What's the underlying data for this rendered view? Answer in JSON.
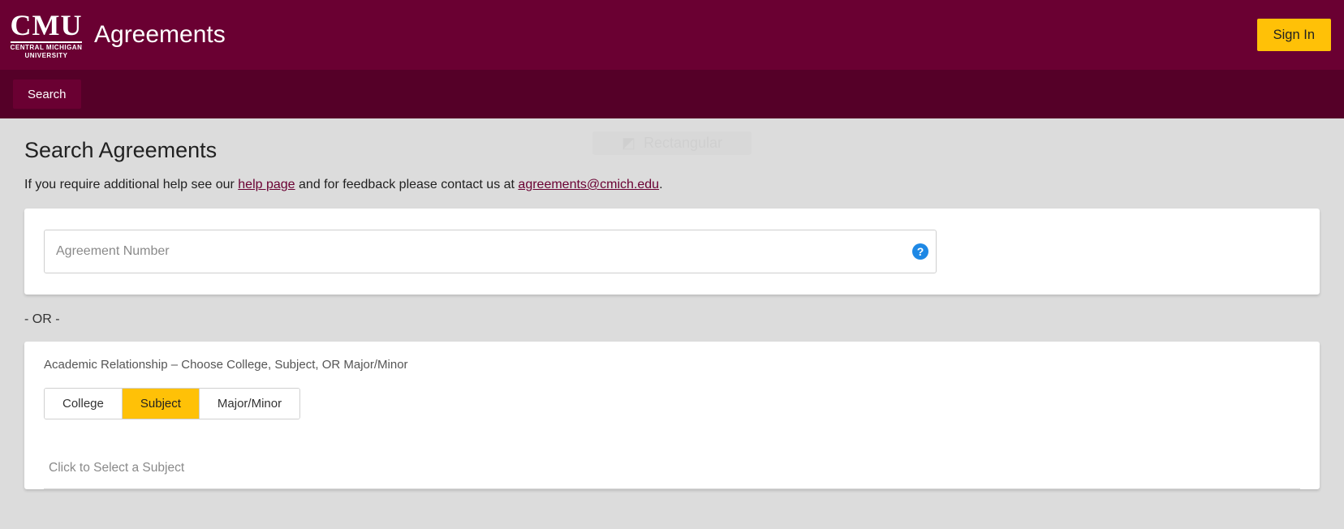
{
  "header": {
    "logo_main": "CMU",
    "logo_sub1": "CENTRAL MICHIGAN",
    "logo_sub2": "UNIVERSITY",
    "app_title": "Agreements",
    "signin_label": "Sign In"
  },
  "nav": {
    "search_label": "Search"
  },
  "page": {
    "title": "Search Agreements",
    "help_prefix": "If you require additional help see our ",
    "help_link_text": "help page",
    "help_mid": " and for feedback please contact us at ",
    "help_email": "agreements@cmich.edu",
    "help_suffix": "."
  },
  "overlay_text": "Rectangular",
  "search1": {
    "agreement_placeholder": "Agreement Number",
    "agreement_value": "",
    "help_icon_char": "?"
  },
  "divider": "- OR -",
  "search2": {
    "academic_label": "Academic Relationship – Choose College, Subject, OR Major/Minor",
    "tabs": {
      "college": "College",
      "subject": "Subject",
      "major_minor": "Major/Minor"
    },
    "active_tab": "subject",
    "subject_placeholder": "Click to Select a Subject"
  }
}
